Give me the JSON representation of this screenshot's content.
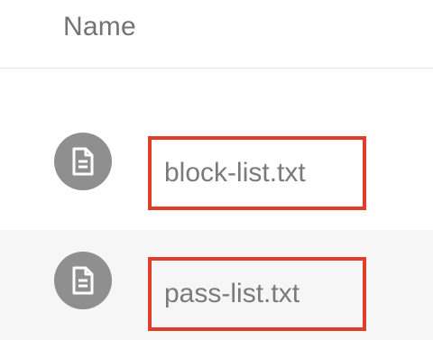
{
  "header": {
    "column_label": "Name"
  },
  "files": [
    {
      "name": "block-list.txt",
      "icon": "document-icon"
    },
    {
      "name": "pass-list.txt",
      "icon": "document-icon"
    }
  ],
  "colors": {
    "highlight_border": "#e03e28",
    "icon_background": "#8f8f8f",
    "text": "#7a7a7a"
  }
}
